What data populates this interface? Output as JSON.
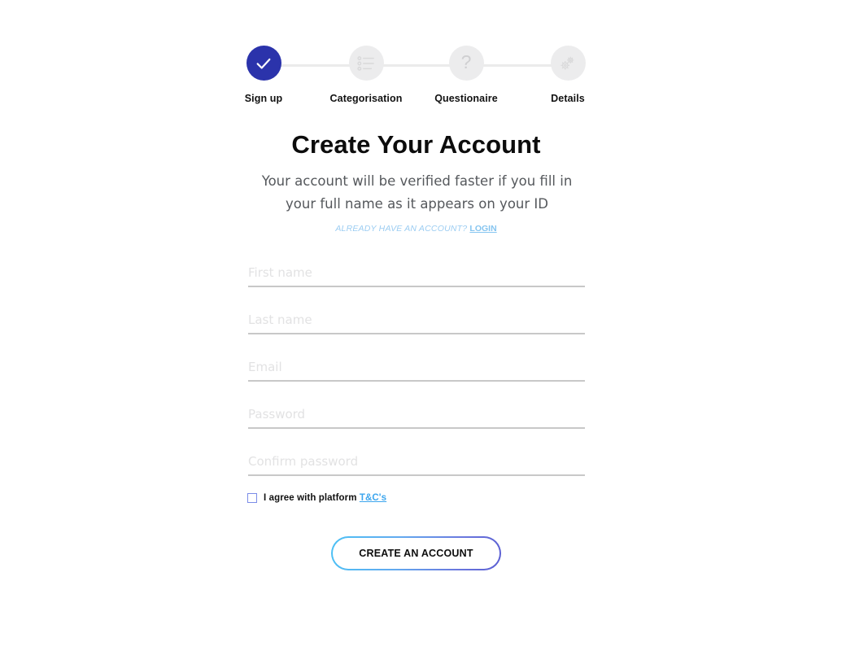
{
  "stepper": {
    "steps": [
      {
        "label": "Sign up",
        "icon": "check-icon",
        "state": "completed"
      },
      {
        "label": "Categorisation",
        "icon": "list-icon",
        "state": "inactive"
      },
      {
        "label": "Questionaire",
        "icon": "question-icon",
        "state": "inactive"
      },
      {
        "label": "Details",
        "icon": "gears-icon",
        "state": "inactive"
      }
    ],
    "active_color": "#2b33ab",
    "inactive_color": "#ececed",
    "track_color": "#ebebeb"
  },
  "page": {
    "title": "Create Your Account",
    "subtitle": "Your account will be verified faster if you fill in your full name as it appears on your ID",
    "login_prompt": "ALREADY HAVE AN ACCOUNT?",
    "login_link": "LOGIN",
    "login_color": "#9ccdf2"
  },
  "form": {
    "fields": [
      {
        "name": "first-name",
        "placeholder": "First name",
        "value": "",
        "type": "text"
      },
      {
        "name": "last-name",
        "placeholder": "Last name",
        "value": "",
        "type": "text"
      },
      {
        "name": "email",
        "placeholder": "Email",
        "value": "",
        "type": "email"
      },
      {
        "name": "password",
        "placeholder": "Password",
        "value": "",
        "type": "password"
      },
      {
        "name": "confirm-password",
        "placeholder": "Confirm password",
        "value": "",
        "type": "password"
      }
    ],
    "agreement": {
      "checked": false,
      "text": "I agree with platform",
      "link_text": "T&C's",
      "link_color": "#3da6ee",
      "box_border_color": "#7b8ce8"
    },
    "submit_label": "CREATE AN ACCOUNT",
    "submit_gradient_from": "#4cc1f5",
    "submit_gradient_to": "#5a5ed2"
  }
}
